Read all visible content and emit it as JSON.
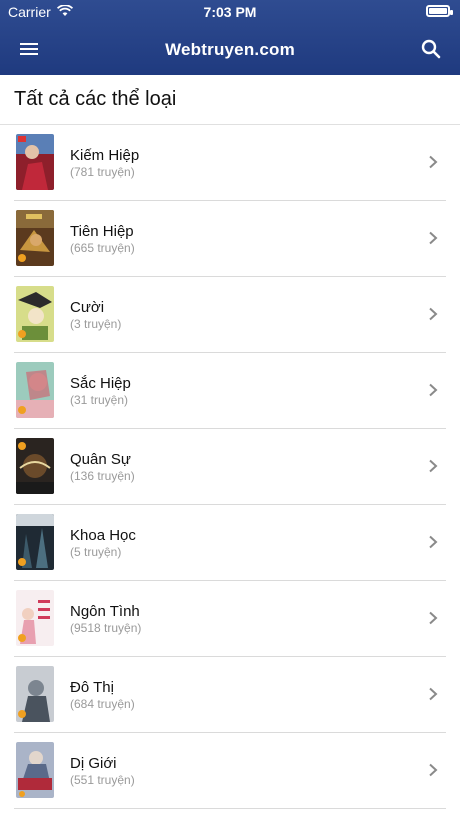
{
  "status_bar": {
    "carrier": "Carrier",
    "time": "7:03 PM"
  },
  "navbar": {
    "title": "Webtruyen.com",
    "menu_icon": "hamburger-menu-icon",
    "search_icon": "search-icon"
  },
  "page": {
    "title": "Tất cả các thể loại"
  },
  "genres": [
    {
      "name": "Kiếm Hiệp",
      "count": "(781 truyện)"
    },
    {
      "name": "Tiên Hiệp",
      "count": "(665 truyện)"
    },
    {
      "name": "Cười",
      "count": "(3 truyện)"
    },
    {
      "name": "Sắc Hiệp",
      "count": "(31 truyện)"
    },
    {
      "name": "Quân Sự",
      "count": "(136 truyện)"
    },
    {
      "name": "Khoa Học",
      "count": "(5 truyện)"
    },
    {
      "name": "Ngôn Tình",
      "count": "(9518 truyện)"
    },
    {
      "name": "Đô Thị",
      "count": "(684 truyện)"
    },
    {
      "name": "Dị Giới",
      "count": "(551 truyện)"
    }
  ],
  "colors": {
    "header": "#27458a",
    "separator": "#dadada",
    "secondary_text": "#9a9a9a"
  }
}
